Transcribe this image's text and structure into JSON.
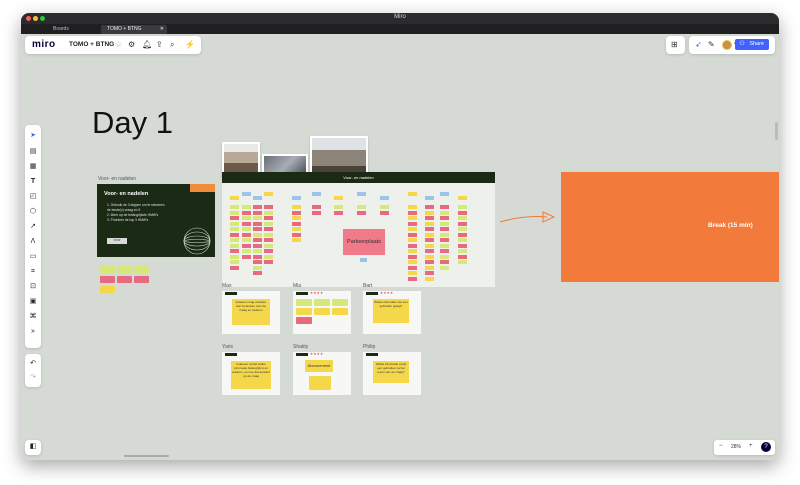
{
  "window": {
    "title": "Miro"
  },
  "tabs": [
    {
      "label": "Boards"
    },
    {
      "label": "TOMO + BTNG"
    }
  ],
  "topbar": {
    "logo": "miro",
    "board_name": "TOMO + BTNG",
    "share_label": "Share"
  },
  "canvas": {
    "day_title": "Day 1",
    "frame_label_left": "Voor- en nadelen",
    "dark_card": {
      "title": "Voor- en nadelen",
      "items": [
        "1. Gebruik de 3 stippen om te stemmen",
        "   de beste(n) vraag en 5",
        "2. Meer op de belangrijkste HMW's",
        "3. Prioriteer de top 3 HMW's"
      ]
    },
    "board_frame_header": "Voor- en nadelen",
    "parker_label": "Parkeerplaats",
    "break_label": "Break (15 min)",
    "mini_frames": [
      {
        "name": "Max",
        "note": "Iedereen mag vertellen wat zij denken over de vraag en waarom"
      },
      {
        "name": "Mia",
        "note": ""
      },
      {
        "name": "Bart",
        "note": "Welke informatie ziet een gebruiker graag?"
      },
      {
        "name": "Yaris",
        "note": "Iedereen vertelt welke informatie belangrijk is en waarom, en hoe dat aansluit op de vraag"
      },
      {
        "name": "Shakty",
        "note": "Abonnement"
      },
      {
        "name": "Philip",
        "note": "Welke informatie zoekt een gebruiker na het lezen van de vraag?"
      }
    ],
    "zoom": {
      "minus": "−",
      "value": "28%",
      "plus": "+"
    }
  },
  "colors": {
    "accent": "#4262ff",
    "break": "#f27a3a",
    "dark_frame": "#1a2a15"
  }
}
